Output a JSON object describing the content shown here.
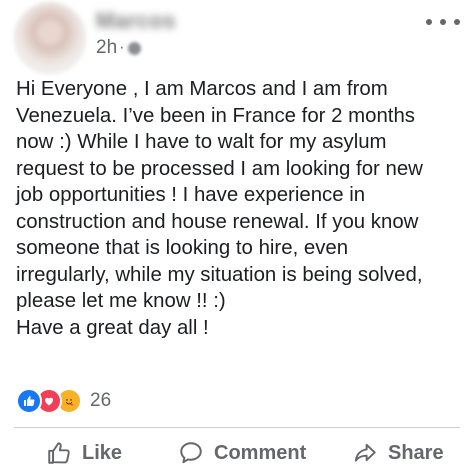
{
  "post": {
    "author": "Marcos",
    "time": "2h",
    "separator": "·",
    "text_lines": [
      "Hi Everyone , I am Marcos and I am from",
      "Venezuela. I’ve been in France for 2 months",
      "now :) While I have to walt for my asylum",
      "request to be processed I am looking for new",
      "job opportunities ! I have experience in",
      "construction and house renewal. If you know",
      "someone that is looking to hire, even",
      "irregularly, while my situation is being solved,",
      "please let me know !! :)",
      "Have a great day all !"
    ],
    "reaction_count": "26",
    "reaction_icons": [
      "like-icon",
      "love-icon",
      "care-icon"
    ]
  },
  "actions": {
    "like": "Like",
    "comment": "Comment",
    "share": "Share"
  },
  "colors": {
    "like_blue": "#1877f2",
    "love_red": "#f33e58",
    "care_yellow": "#f7b125",
    "meta_gray": "#65676b"
  }
}
